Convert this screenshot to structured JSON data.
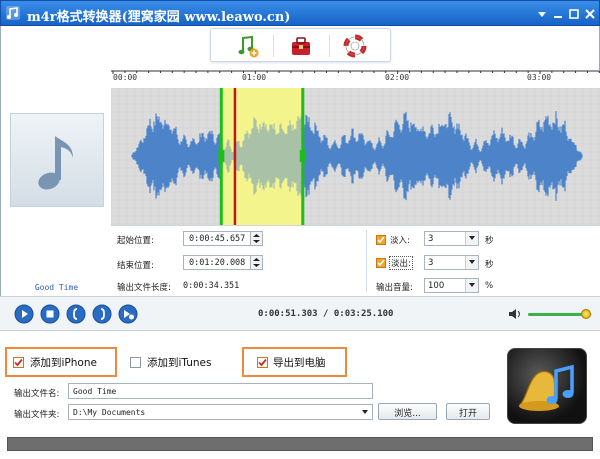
{
  "window": {
    "title": "m4r格式转换器(狸窝家园  www.leawo.cn)",
    "accent_color": "#1a6bd0"
  },
  "toolbar": {
    "buttons": [
      {
        "name": "add-file",
        "icon": "music-add-icon"
      },
      {
        "name": "toolbox",
        "icon": "toolbox-icon"
      },
      {
        "name": "help",
        "icon": "lifebuoy-icon"
      }
    ]
  },
  "track": {
    "caption": "Good Time",
    "icon": "music-note-icon"
  },
  "ruler": {
    "labels": [
      "00:00",
      "01:00",
      "02:00",
      "03:00"
    ]
  },
  "waveform": {
    "duration_seconds": 205.1,
    "selection_start_seconds": 45.657,
    "selection_end_seconds": 80.008,
    "playhead_seconds": 51.303,
    "colors": {
      "wave": "#4d83c8",
      "selection": "#f4f48c",
      "marker": "#19c019",
      "playhead": "#c01818"
    }
  },
  "controls": {
    "start_label": "起始位置:",
    "start_value": "0:00:45.657",
    "end_label": "结束位置:",
    "end_value": "0:01:20.008",
    "length_label": "输出文件长度:",
    "length_value": "0:00:34.351",
    "fade_in_label": "淡入:",
    "fade_in_value": "3",
    "fade_in_checked": true,
    "fade_out_label": "淡出:",
    "fade_out_value": "3",
    "fade_out_checked": true,
    "seconds_unit": "秒",
    "volume_label": "输出音量:",
    "volume_value": "100",
    "percent_unit": "%"
  },
  "playback": {
    "time_display": "0:00:51.303 / 0:03:25.100",
    "volume_level": 0.9,
    "buttons": [
      "play-icon",
      "stop-icon",
      "mark-start-icon",
      "mark-end-icon",
      "play-selection-icon"
    ]
  },
  "options": {
    "add_iphone_label": "添加到iPhone",
    "add_iphone_checked": true,
    "add_itunes_label": "添加到iTunes",
    "add_itunes_checked": false,
    "export_pc_label": "导出到电脑",
    "export_pc_checked": true,
    "highlight_color": "#f08a3a"
  },
  "output": {
    "filename_label": "输出文件名:",
    "filename_value": "Good Time",
    "folder_label": "输出文件夹:",
    "folder_value": "D:\\My Documents",
    "browse_label": "浏览...",
    "open_label": "打开"
  }
}
